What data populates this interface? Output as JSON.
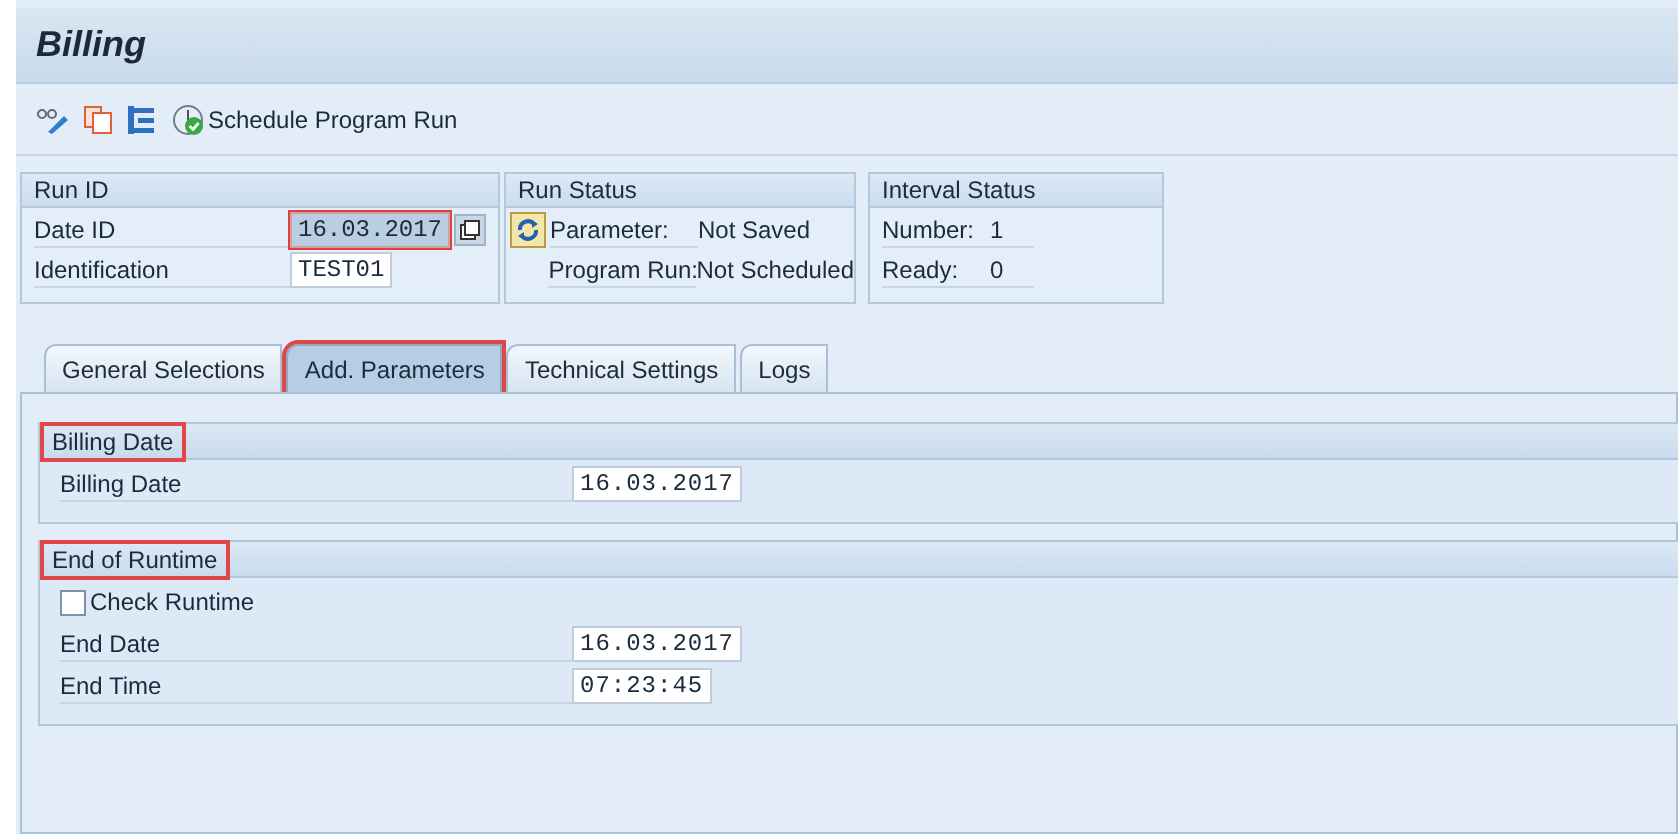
{
  "window": {
    "title": "Billing"
  },
  "toolbar": {
    "button_label": "Schedule Program Run"
  },
  "run_id": {
    "title": "Run ID",
    "fields": [
      {
        "label": "Date ID",
        "value": "16.03.2017",
        "focused": true
      },
      {
        "label": "Identification",
        "value": "TEST01",
        "focused": false
      }
    ]
  },
  "run_status": {
    "title": "Run Status",
    "rows": [
      {
        "label": "Parameter:",
        "value": "Not Saved"
      },
      {
        "label": "Program Run:",
        "value": "Not Scheduled"
      }
    ]
  },
  "interval_status": {
    "title": "Interval Status",
    "rows": [
      {
        "label": "Number:",
        "value": "1"
      },
      {
        "label": "Ready:",
        "value": "0"
      }
    ]
  },
  "tabs": [
    {
      "label": "General Selections",
      "selected": false,
      "highlighted": false
    },
    {
      "label": "Add. Parameters",
      "selected": true,
      "highlighted": true
    },
    {
      "label": "Technical Settings",
      "selected": false,
      "highlighted": false
    },
    {
      "label": "Logs",
      "selected": false,
      "highlighted": false
    }
  ],
  "groups": [
    {
      "title": "Billing Date",
      "highlighted": true,
      "rows": [
        {
          "kind": "field",
          "label": "Billing Date",
          "value": "16.03.2017"
        }
      ]
    },
    {
      "title": "End of Runtime",
      "highlighted": true,
      "rows": [
        {
          "kind": "checkbox",
          "label": "Check Runtime",
          "checked": false
        },
        {
          "kind": "field",
          "label": "End Date",
          "value": "16.03.2017"
        },
        {
          "kind": "field",
          "label": "End Time",
          "value": "07:23:45"
        }
      ]
    }
  ]
}
